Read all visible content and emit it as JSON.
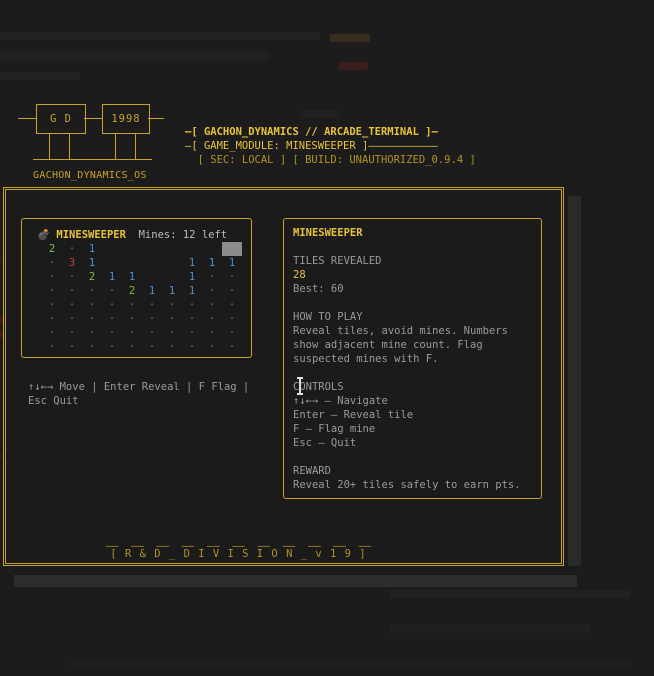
{
  "logo": {
    "box1": "G D",
    "box2": "1998",
    "caption": "GACHON_DYNAMICS_OS"
  },
  "header": {
    "line1": "—[ GACHON_DYNAMICS // ARCADE_TERMINAL ]—",
    "line2": "—[ GAME_MODULE: MINESWEEPER ]———————————",
    "line3": "  [ SEC: LOCAL ] [ BUILD: UNAUTHORIZED_0.9.4 ]"
  },
  "game": {
    "icon": "bomb-icon",
    "title": "MINESWEEPER",
    "mines_label": "Mines: 12 left",
    "board": [
      [
        "2",
        "·",
        "1",
        "",
        "",
        "",
        "",
        "",
        "",
        "#"
      ],
      [
        "·",
        "3",
        "1",
        "",
        "",
        "",
        "",
        "1",
        "1",
        "1"
      ],
      [
        "·",
        "·",
        "2",
        "1",
        "1",
        "",
        "",
        "1",
        "·",
        "·"
      ],
      [
        "·",
        "·",
        "·",
        "·",
        "2",
        "1",
        "1",
        "1",
        "·",
        "·"
      ],
      [
        "·",
        "·",
        "·",
        "·",
        "·",
        "·",
        "·",
        "·",
        "·",
        "·"
      ],
      [
        "·",
        "·",
        "·",
        "·",
        "·",
        "·",
        "·",
        "·",
        "·",
        "·"
      ],
      [
        "·",
        "·",
        "·",
        "·",
        "·",
        "·",
        "·",
        "·",
        "·",
        "·"
      ],
      [
        "·",
        "·",
        "·",
        "·",
        "·",
        "·",
        "·",
        "·",
        "·",
        "·"
      ]
    ],
    "controls_hint": "↑↓←→ Move  |  Enter Reveal  |  F Flag  |  Esc Quit"
  },
  "info": {
    "title": "MINESWEEPER",
    "tiles_label": "TILES REVEALED",
    "tiles_value": "28",
    "best": "Best: 60",
    "how_title": "HOW TO PLAY",
    "how_text": "Reveal tiles, avoid mines. Numbers show adjacent mine count. Flag suspected mines with F.",
    "controls_title": "CONTROLS",
    "controls": [
      "↑↓←→ — Navigate",
      "Enter — Reveal tile",
      "F — Flag mine",
      "Esc — Quit"
    ],
    "reward_title": "REWARD",
    "reward_text": "Reveal 20+ tiles safely to earn pts."
  },
  "footer": {
    "dashes": "——  ——  ——  ——  ——  ——  ——  ——  ——  ——  ——",
    "division": "[ R & D _ D I V I S I O N _ v 1 9 ]"
  },
  "colors": {
    "accent": "#c9a227",
    "title": "#e8c33a",
    "n1": "#4f8fd0",
    "n2": "#7fbf3f",
    "n3": "#d03a3a"
  }
}
